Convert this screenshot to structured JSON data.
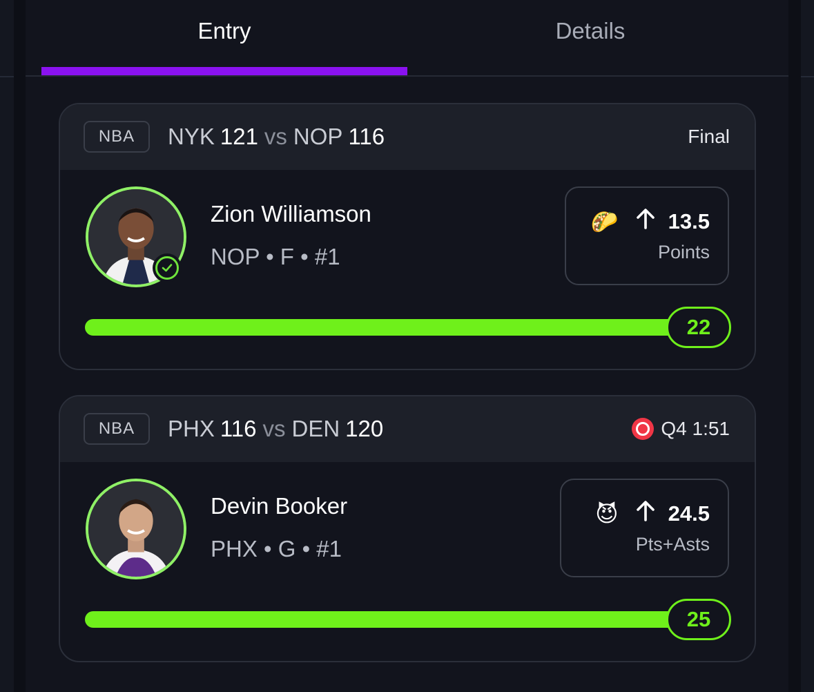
{
  "tabs": [
    {
      "label": "Entry",
      "active": true
    },
    {
      "label": "Details",
      "active": false
    }
  ],
  "colors": {
    "accent": "#8a12f0",
    "progress": "#6ff01b",
    "live": "#f03646"
  },
  "picks": [
    {
      "league": "NBA",
      "away_team": "NYK",
      "away_score": "121",
      "vs": "vs",
      "home_team": "NOP",
      "home_score": "116",
      "status": "Final",
      "live": false,
      "player_name": "Zion Williamson",
      "player_meta": "NOP • F • #1",
      "pick_emoji": "🌮",
      "direction": "up-arrow-icon",
      "line": "13.5",
      "stat": "Points",
      "actual": "22",
      "progress": 1.0,
      "hit": true
    },
    {
      "league": "NBA",
      "away_team": "PHX",
      "away_score": "116",
      "vs": "vs",
      "home_team": "DEN",
      "home_score": "120",
      "status": "Q4 1:51",
      "live": true,
      "player_name": "Devin Booker",
      "player_meta": "PHX • G • #1",
      "pick_emoji": "😈",
      "direction": "up-arrow-icon",
      "line": "24.5",
      "stat": "Pts+Asts",
      "actual": "25",
      "progress": 1.0,
      "hit": false
    }
  ]
}
